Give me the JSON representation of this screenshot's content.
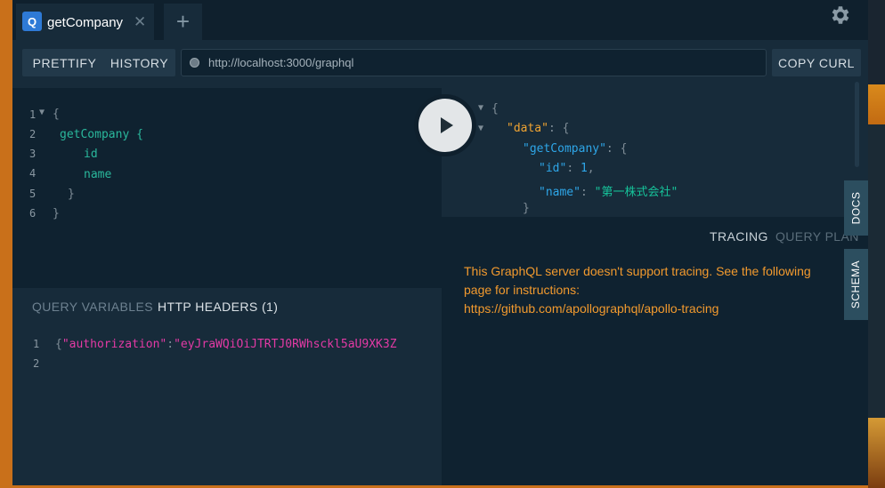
{
  "tabs": [
    {
      "icon_letter": "Q",
      "title": "getCompany"
    }
  ],
  "toolbar": {
    "prettify_label": "PRETTIFY",
    "history_label": "HISTORY",
    "endpoint": "http://localhost:3000/graphql",
    "copy_curl_label": "COPY CURL"
  },
  "query_editor": {
    "line_numbers": [
      "1",
      "2",
      "3",
      "4",
      "5",
      "6"
    ],
    "lines": [
      "{",
      "getCompany {",
      "id",
      "name",
      "}",
      "}"
    ]
  },
  "bottom_tabs": {
    "query_variables_label": "QUERY VARIABLES",
    "http_headers_label": "HTTP HEADERS (1)"
  },
  "headers_editor": {
    "line_numbers": [
      "1",
      "2"
    ],
    "open": "{",
    "key": "\"authorization\"",
    "colon": ":",
    "value": "\"eyJraWQiOiJTRTJ0RWhsckl5aU9XK3Z"
  },
  "result": {
    "open": "{",
    "data_key": "\"data\"",
    "getCompany_key": "\"getCompany\"",
    "id_key": "\"id\"",
    "id_value": "1",
    "name_key": "\"name\"",
    "name_value": "\"第一株式会社\"",
    "close": "}"
  },
  "tracing": {
    "tracing_label": "TRACING",
    "query_plan_label": "QUERY PLAN",
    "message_line1": "This GraphQL server doesn't support tracing. See the following",
    "message_line2": "page for instructions:",
    "message_link": "https://github.com/apollographql/apollo-tracing"
  },
  "side": {
    "docs_label": "DOCS",
    "schema_label": "SCHEMA"
  },
  "colors": {
    "panel": "#172b3a",
    "editor": "#0f2230",
    "accent_field": "#2ab89c",
    "accent_key": "#f0a432",
    "accent_string": "#16c39a",
    "tracing_text": "#f29a2e"
  }
}
